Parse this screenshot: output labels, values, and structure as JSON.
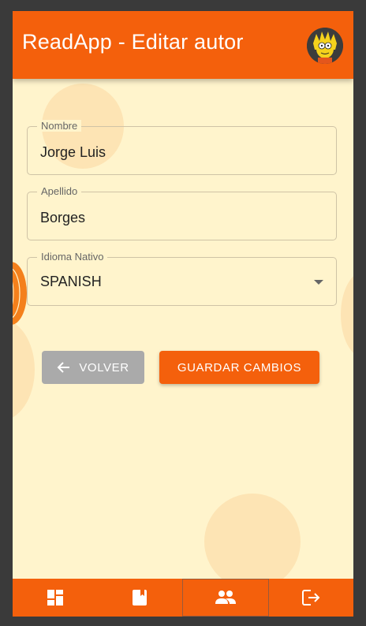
{
  "app": {
    "title": "ReadApp - Editar autor",
    "accent": "#f4600c",
    "background": "#fff4cc"
  },
  "user": {
    "avatar_icon": "lisa-simpson-avatar"
  },
  "form": {
    "nombre": {
      "label": "Nombre",
      "value": "Jorge Luis"
    },
    "apellido": {
      "label": "Apellido",
      "value": "Borges"
    },
    "idioma": {
      "label": "Idioma Nativo",
      "value": "SPANISH"
    }
  },
  "buttons": {
    "back_label": "VOLVER",
    "save_label": "GUARDAR CAMBIOS"
  },
  "bottom_nav": {
    "items": [
      {
        "icon": "dashboard-icon",
        "active": false
      },
      {
        "icon": "book-icon",
        "active": false
      },
      {
        "icon": "people-icon",
        "active": true
      },
      {
        "icon": "logout-icon",
        "active": false
      }
    ]
  }
}
